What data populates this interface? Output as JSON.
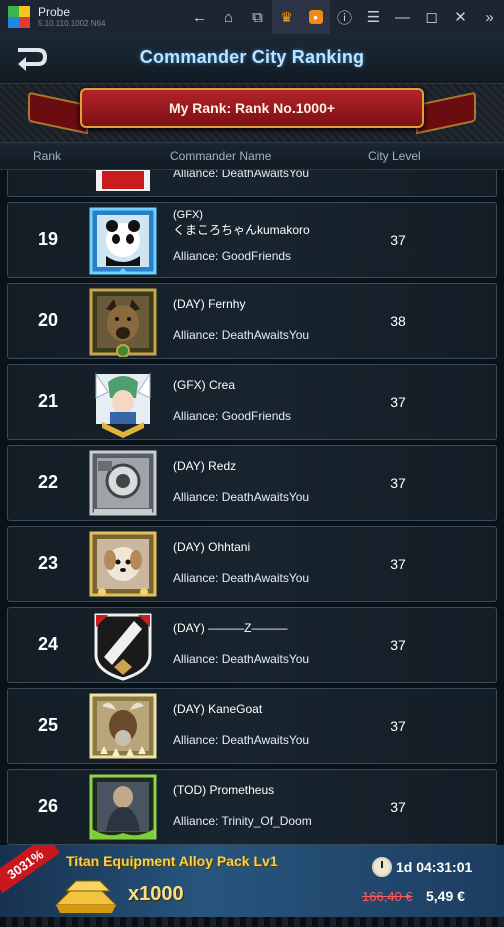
{
  "emulator": {
    "app_name": "Probe",
    "version": "5.10.110.1002 N64",
    "icons": [
      "back-arrow-icon",
      "home-icon",
      "multi-window-icon",
      "crown-icon",
      "hex-badge-icon",
      "help-icon",
      "menu-icon",
      "minimize-icon",
      "maximize-icon",
      "close-icon",
      "expand-icon"
    ]
  },
  "header": {
    "title": "Commander City Ranking"
  },
  "banner": {
    "my_rank": "My Rank: Rank No.1000+"
  },
  "columns": {
    "rank": "Rank",
    "name": "Commander Name",
    "level": "City Level"
  },
  "partial_row": {
    "alliance": "Alliance:  DeathAwaitsYou"
  },
  "rows": [
    {
      "rank": "19",
      "name_tag": "(GFX)",
      "name": "くまころちゃんkumakoro",
      "alliance": "Alliance:  GoodFriends",
      "level": "37"
    },
    {
      "rank": "20",
      "name": "(DAY) Fernhy",
      "alliance": "Alliance:  DeathAwaitsYou",
      "level": "38"
    },
    {
      "rank": "21",
      "name": "(GFX) Crea",
      "alliance": "Alliance:  GoodFriends",
      "level": "37"
    },
    {
      "rank": "22",
      "name": "(DAY) Redz",
      "alliance": "Alliance:  DeathAwaitsYou",
      "level": "37"
    },
    {
      "rank": "23",
      "name": "(DAY) Ohhtani",
      "alliance": "Alliance:  DeathAwaitsYou",
      "level": "37"
    },
    {
      "rank": "24",
      "name": "(DAY) ———Z———",
      "alliance": "Alliance:  DeathAwaitsYou",
      "level": "37"
    },
    {
      "rank": "25",
      "name": "(DAY) KaneGoat",
      "alliance": "Alliance:  DeathAwaitsYou",
      "level": "37"
    },
    {
      "rank": "26",
      "name": "(TOD) Prometheus",
      "alliance": "Alliance:  Trinity_Of_Doom",
      "level": "37"
    }
  ],
  "promo": {
    "badge": "3031%",
    "title": "Titan Equipment Alloy Pack Lv1",
    "quantity": "x1000",
    "timer": "1d 04:31:01",
    "old_price": "166,40 €",
    "new_price": "5,49 €"
  }
}
